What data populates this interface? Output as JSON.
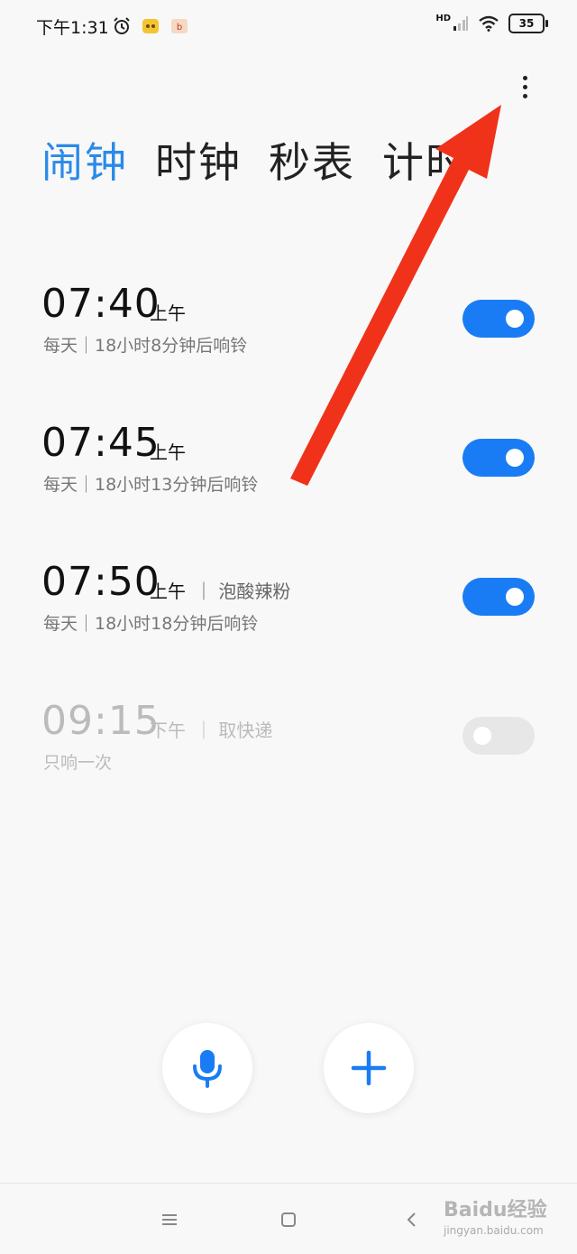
{
  "status": {
    "time": "下午1:31",
    "network": "HD",
    "battery": "35"
  },
  "tabs": [
    {
      "label": "闹钟",
      "active": true
    },
    {
      "label": "时钟",
      "active": false
    },
    {
      "label": "秒表",
      "active": false
    },
    {
      "label": "计时",
      "active": false
    }
  ],
  "alarms": [
    {
      "time": "07:40",
      "ampm": "上午",
      "note": "",
      "sub": "每天｜18小时8分钟后响铃",
      "enabled": true
    },
    {
      "time": "07:45",
      "ampm": "上午",
      "note": "",
      "sub": "每天｜18小时13分钟后响铃",
      "enabled": true
    },
    {
      "time": "07:50",
      "ampm": "上午",
      "note": "｜ 泡酸辣粉",
      "sub": "每天｜18小时18分钟后响铃",
      "enabled": true
    },
    {
      "time": "09:15",
      "ampm": "下午",
      "note": "｜ 取快递",
      "sub": "只响一次",
      "enabled": false
    }
  ],
  "colors": {
    "accent": "#1a7cf4",
    "tab_active": "#2a8ae8",
    "annotation_arrow": "#f0321a"
  },
  "watermark": {
    "brand": "Baidu经验",
    "url": "jingyan.baidu.com"
  }
}
